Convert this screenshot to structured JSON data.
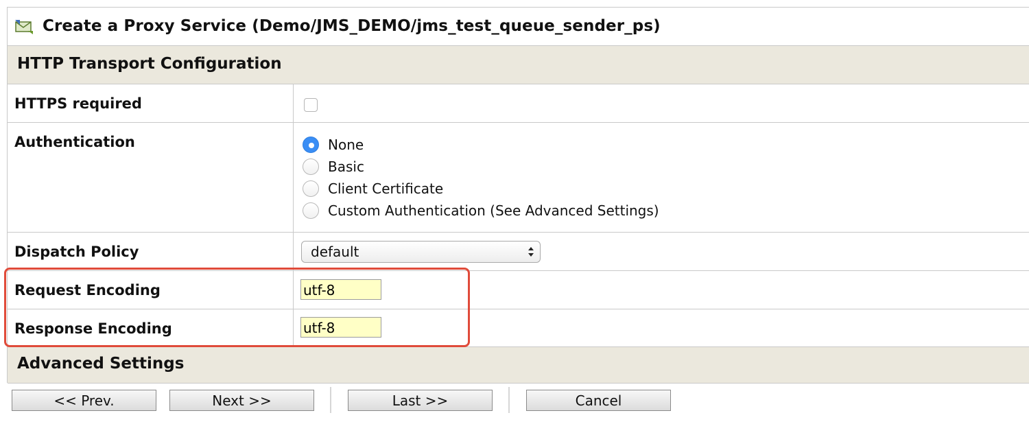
{
  "window": {
    "title": "Create a Proxy Service (Demo/JMS_DEMO/jms_test_queue_sender_ps)"
  },
  "sections": {
    "http_transport": "HTTP Transport Configuration",
    "advanced": "Advanced Settings"
  },
  "form": {
    "https_required": {
      "label": "HTTPS required",
      "checked": false
    },
    "authentication": {
      "label": "Authentication",
      "options": [
        "None",
        "Basic",
        "Client Certificate",
        "Custom Authentication (See Advanced Settings)"
      ],
      "selected": "None"
    },
    "dispatch_policy": {
      "label": "Dispatch Policy",
      "value": "default"
    },
    "request_encoding": {
      "label": "Request Encoding",
      "value": "utf-8"
    },
    "response_encoding": {
      "label": "Response Encoding",
      "value": "utf-8"
    }
  },
  "buttons": {
    "prev": "<< Prev.",
    "next": "Next >>",
    "last": "Last >>",
    "cancel": "Cancel"
  },
  "colors": {
    "section_bg": "#ebe8dd",
    "input_bg": "#ffffc6",
    "highlight": "#e04b3a",
    "radio_selected": "#3a8ef5"
  },
  "icons": {
    "title": "proxy-service-icon"
  }
}
